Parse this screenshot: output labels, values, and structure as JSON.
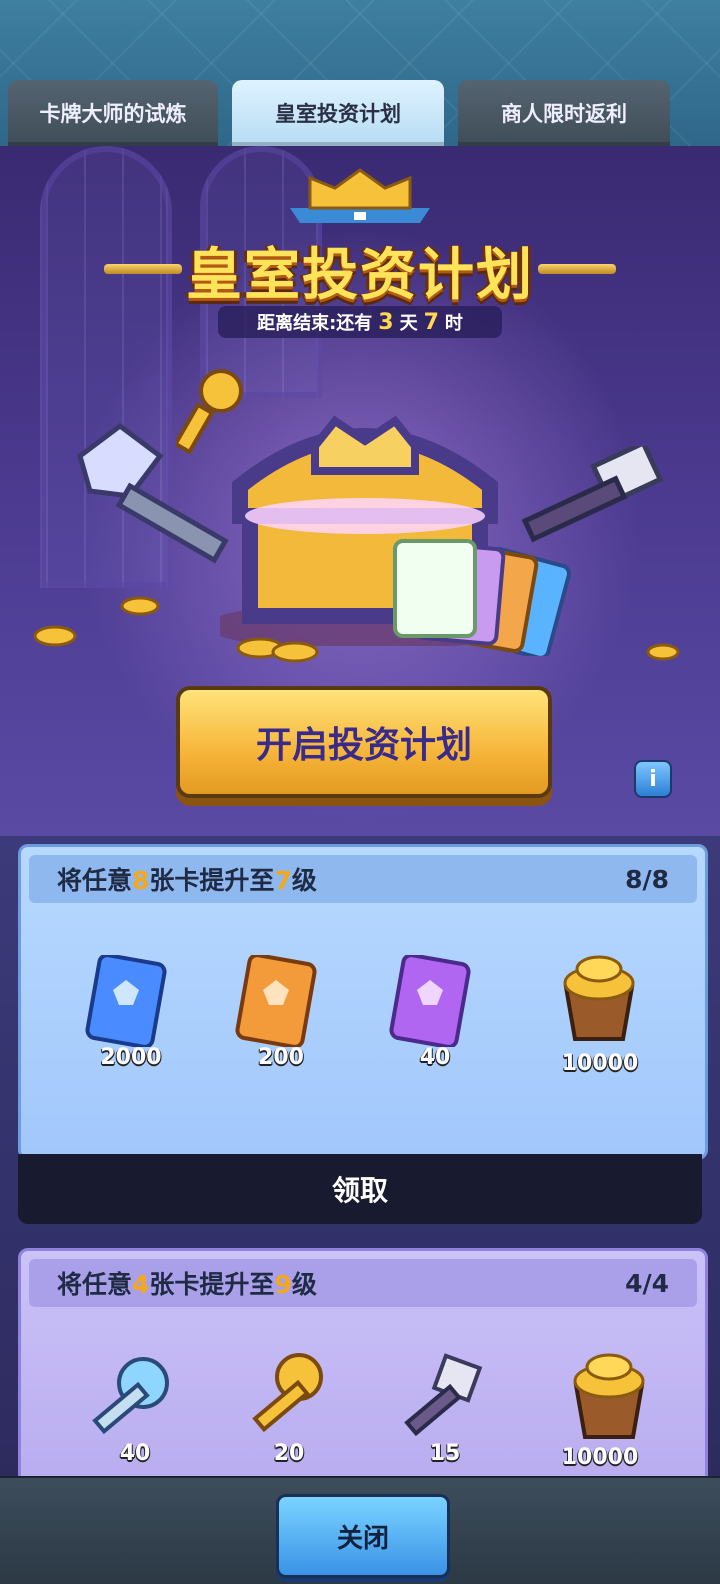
{
  "tabs": [
    {
      "label": "卡牌大师的试炼",
      "active": false
    },
    {
      "label": "皇室投资计划",
      "active": true
    },
    {
      "label": "商人限时返利",
      "active": false
    }
  ],
  "hero": {
    "title": "皇室投资计划",
    "countdown_prefix": "距离结束:还有",
    "countdown_days": "3",
    "countdown_days_unit": "天",
    "countdown_hours": "7",
    "countdown_hours_unit": "时"
  },
  "open_button_label": "开启投资计划",
  "info_button_label": "i",
  "tasks": [
    {
      "title_parts": [
        "将任意",
        "8",
        "张卡提升至",
        "7",
        "级"
      ],
      "progress": "8/8",
      "rewards": [
        {
          "icon": "blue-card-icon",
          "amount": "2000"
        },
        {
          "icon": "orange-card-icon",
          "amount": "200"
        },
        {
          "icon": "purple-card-icon",
          "amount": "40"
        },
        {
          "icon": "gold-bucket-icon",
          "amount": "10000"
        }
      ],
      "claim_label": "领取"
    },
    {
      "title_parts": [
        "将任意",
        "4",
        "张卡提升至",
        "9",
        "级"
      ],
      "progress": "4/4",
      "rewards": [
        {
          "icon": "diamond-key-icon",
          "amount": "40"
        },
        {
          "icon": "gold-key-icon",
          "amount": "20"
        },
        {
          "icon": "silver-key-icon",
          "amount": "15"
        },
        {
          "icon": "gold-bucket-icon",
          "amount": "10000"
        }
      ]
    }
  ],
  "close_button_label": "关闭"
}
